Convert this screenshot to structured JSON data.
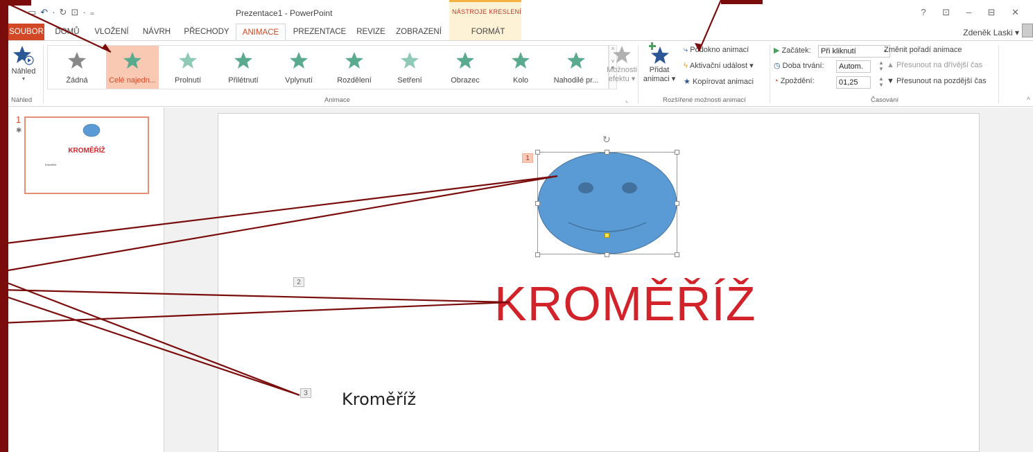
{
  "title_bar": {
    "document_title": "Prezentace1 - PowerPoint",
    "context_tab_title": "NÁSTROJE KRESLENÍ",
    "window_controls": "? ⊡ – ⊟ ✕"
  },
  "tabs": [
    {
      "label": "SOUBOR"
    },
    {
      "label": "DOMŮ"
    },
    {
      "label": "VLOŽENÍ"
    },
    {
      "label": "NÁVRH"
    },
    {
      "label": "PŘECHODY"
    },
    {
      "label": "ANIMACE"
    },
    {
      "label": "PREZENTACE"
    },
    {
      "label": "REVIZE"
    },
    {
      "label": "ZOBRAZENÍ"
    },
    {
      "label": "FORMÁT"
    }
  ],
  "user_name": "Zdeněk Laski",
  "ribbon": {
    "preview": {
      "label": "Náhled",
      "group_label": "Náhled"
    },
    "gallery": {
      "group_label": "Animace",
      "items": [
        {
          "label": "Žádná",
          "color": "#888888"
        },
        {
          "label": "Celé najedn...",
          "color": "#5aaa8e",
          "selected": true
        },
        {
          "label": "Prolnutí",
          "color": "#8fcab5"
        },
        {
          "label": "Přilétnutí",
          "color": "#5aaa8e"
        },
        {
          "label": "Vplynutí",
          "color": "#5aaa8e"
        },
        {
          "label": "Rozdělení",
          "color": "#5aaa8e"
        },
        {
          "label": "Setření",
          "color": "#8fcab5"
        },
        {
          "label": "Obrazec",
          "color": "#5aaa8e"
        },
        {
          "label": "Kolo",
          "color": "#5aaa8e"
        },
        {
          "label": "Nahodilé pr...",
          "color": "#5aaa8e"
        }
      ]
    },
    "effect_options": {
      "label_line1": "Možnosti",
      "label_line2": "efektu"
    },
    "advanced": {
      "group_label": "Rozšířené možnosti animací",
      "add_line1": "Přidat",
      "add_line2": "animaci",
      "pane": "Podokno animací",
      "trigger": "Aktivační událost",
      "painter": "Kopírovat animaci"
    },
    "timing": {
      "group_label": "Časování",
      "start_label": "Začátek:",
      "start_value": "Při kliknutí",
      "duration_label": "Doba trvání:",
      "duration_value": "Autom.",
      "delay_label": "Zpoždění:",
      "delay_value": "01,25",
      "reorder_title": "Změnit pořadí animace",
      "move_earlier": "Přesunout na dřívější čas",
      "move_later": "Přesunout na pozdější čas"
    }
  },
  "thumbnail": {
    "number": "1",
    "title": "KROMĚŘÍŽ",
    "subtitle": "Kroměříž"
  },
  "slide": {
    "tags": [
      "1",
      "2",
      "3"
    ],
    "title": "KROMĚŘÍŽ",
    "body": "Kroměříž"
  },
  "colors": {
    "accent": "#d24726",
    "frame": "#7a0c0c",
    "title_red": "#d2232a",
    "smiley_fill": "#5b9bd5"
  }
}
